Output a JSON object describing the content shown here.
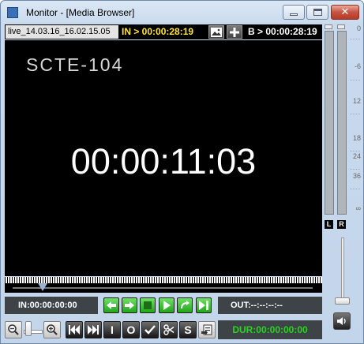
{
  "window": {
    "title": "Monitor - [Media Browser]",
    "close_glyph": "✕"
  },
  "top_bar": {
    "clip_name": "live_14.03.16_16.02.15.05",
    "in_timecode": "IN > 00:00:28:19",
    "b_timecode": "B > 00:00:28:19",
    "icons": [
      "image-icon",
      "plus-icon"
    ]
  },
  "video": {
    "overlay_label": "SCTE-104",
    "timecode": "00:00:11:03"
  },
  "audio_meters": {
    "channels": [
      "L",
      "R"
    ],
    "scale": [
      "0",
      "-6",
      "12",
      "18",
      "24",
      "36",
      "∞"
    ]
  },
  "transport": {
    "in_label": "IN:00:00:00:00",
    "out_label": "OUT:--:--:--:--",
    "duration_label": "DUR:00:00:00:00",
    "letter_buttons": {
      "in": "I",
      "out": "O",
      "split": "S"
    }
  },
  "colors": {
    "in_timecode": "#ffe23a",
    "duration": "#29d31f",
    "transport_green": "#22a51b"
  }
}
